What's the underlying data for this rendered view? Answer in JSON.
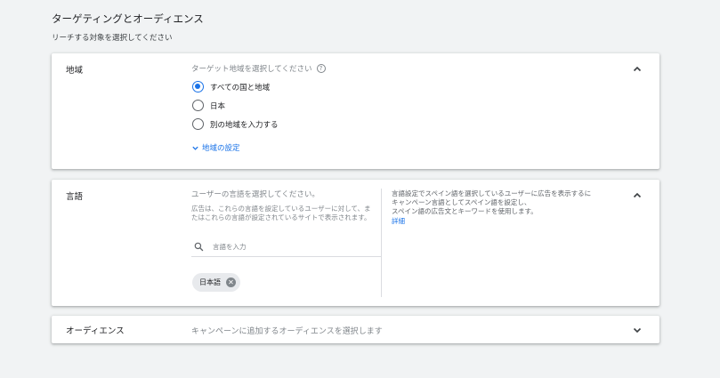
{
  "header": {
    "title": "ターゲティングとオーディエンス",
    "subtitle": "リーチする対象を選択してください"
  },
  "region": {
    "label": "地域",
    "prompt": "ターゲット地域を選択してください",
    "help_icon": "?",
    "options": [
      {
        "label": "すべての国と地域",
        "selected": true
      },
      {
        "label": "日本",
        "selected": false
      },
      {
        "label": "別の地域を入力する",
        "selected": false
      }
    ],
    "settings_link": "地域の設定",
    "expanded": true
  },
  "language": {
    "label": "言語",
    "prompt": "ユーザーの言語を選択してください。",
    "description": "広告は、これらの言語を設定しているユーザーに対して、またはこれらの言語が設定されているサイトで表示されます。",
    "search_placeholder": "言語を入力",
    "search_value": "",
    "chips": [
      "日本語"
    ],
    "chip_remove_glyph": "✕",
    "info_lines": [
      "言語設定でスペイン語を選択しているユーザーに広告を表示するに",
      "キャンペーン言語としてスペイン語を設定し、",
      "スペイン語の広告文とキーワードを使用します。"
    ],
    "info_link": "詳細",
    "expanded": true
  },
  "audience": {
    "label": "オーディエンス",
    "prompt": "キャンペーンに追加するオーディエンスを選択します",
    "expanded": false
  },
  "colors": {
    "accent": "#1a73e8",
    "background": "#f1f3f4",
    "card": "#ffffff",
    "muted_text": "#80868b"
  },
  "icons": {
    "collapse": "chevron-up-icon",
    "expand": "chevron-down-icon",
    "search": "search-icon",
    "help": "help-icon",
    "chip_remove": "close-circle-icon"
  }
}
